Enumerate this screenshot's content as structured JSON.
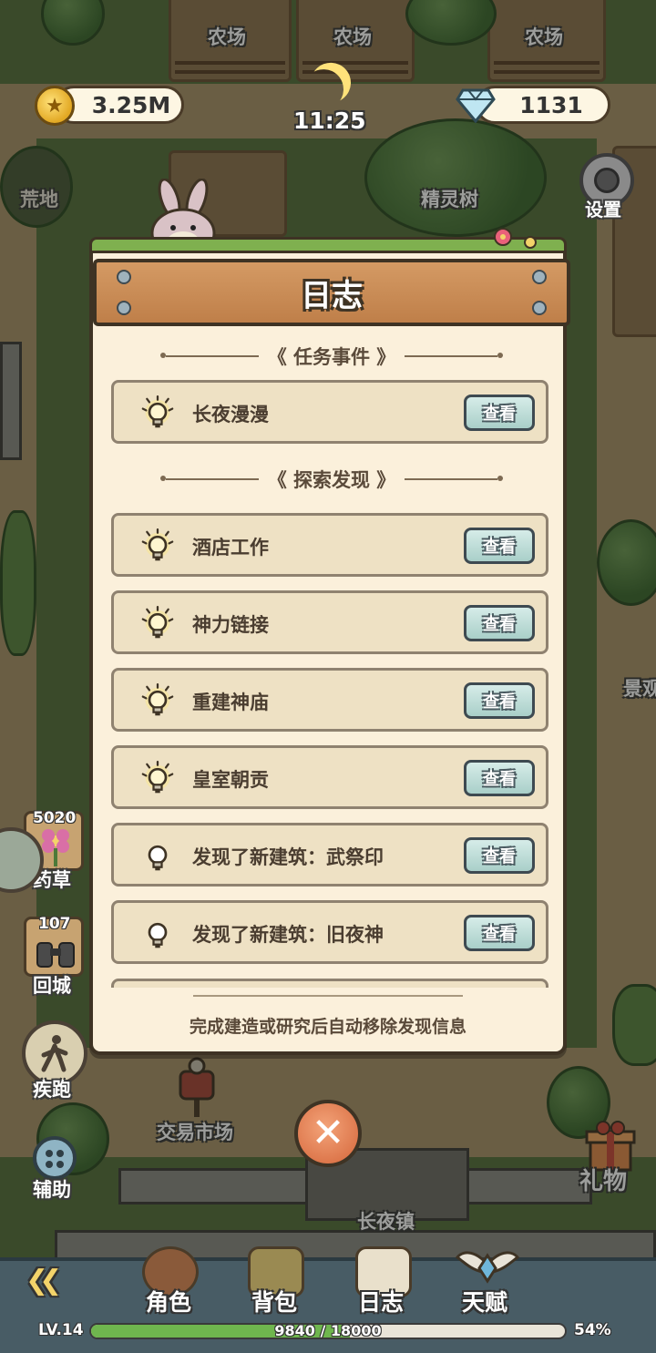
{
  "hud": {
    "coins": "3.25M",
    "time": "11:25",
    "gems": "1131",
    "settings_label": "设置"
  },
  "map_labels": {
    "farm_1": "农场",
    "farm_2": "农场",
    "farm_3": "农场",
    "wasteland": "荒地",
    "spirit_tree": "精灵树",
    "market": "交易市场",
    "town": "长夜镇",
    "gift": "礼物",
    "scenery": "景观"
  },
  "side": {
    "herb_count": "5020",
    "herb_label": "药草",
    "return_count": "107",
    "return_label": "回城",
    "sprint_label": "疾跑",
    "assist_label": "辅助"
  },
  "modal": {
    "title": "日志",
    "section_tasks": "任务事件",
    "section_explore": "探索发现",
    "view_label": "查看",
    "task_items": [
      {
        "label": "长夜漫漫",
        "lit": true
      }
    ],
    "explore_items": [
      {
        "label": "酒店工作",
        "lit": true
      },
      {
        "label": "神力链接",
        "lit": true
      },
      {
        "label": "重建神庙",
        "lit": true
      },
      {
        "label": "皇室朝贡",
        "lit": true
      },
      {
        "label": "发现了新建筑：武祭印",
        "lit": false
      },
      {
        "label": "发现了新建筑：旧夜神",
        "lit": false
      }
    ],
    "footer_note": "完成建造或研究后自动移除发现信息"
  },
  "nav": {
    "character": "角色",
    "backpack": "背包",
    "log": "日志",
    "talent": "天赋"
  },
  "status": {
    "level": "LV.14",
    "xp_text": "9840 / 18000",
    "xp_fraction": 0.5467,
    "percent": "54%"
  }
}
